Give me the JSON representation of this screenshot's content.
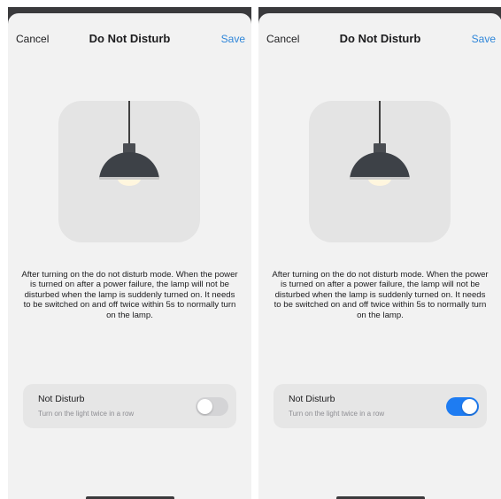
{
  "screens": [
    {
      "nav": {
        "cancel": "Cancel",
        "title": "Do Not Disturb",
        "save": "Save"
      },
      "description": "After turning on the do not disturb mode. When the power is turned on after a power failure, the lamp will not be disturbed when the lamp is suddenly turned on. It needs to be switched on and off twice within 5s to normally turn on the lamp.",
      "setting": {
        "title": "Not Disturb",
        "subtitle": "Turn on the light twice in a row",
        "enabled": false
      }
    },
    {
      "nav": {
        "cancel": "Cancel",
        "title": "Do Not Disturb",
        "save": "Save"
      },
      "description": "After turning on the do not disturb mode. When the power is turned on after a power failure, the lamp will not be disturbed when the lamp is suddenly turned on. It needs to be switched on and off twice within 5s to normally turn on the lamp.",
      "setting": {
        "title": "Not Disturb",
        "subtitle": "Turn on the light twice in a row",
        "enabled": true
      }
    }
  ],
  "colors": {
    "accent": "#2f86d9",
    "toggle_on": "#1e7cf2",
    "toggle_off": "#d4d4d6"
  },
  "icons": {
    "illustration": "pendant-lamp-icon"
  }
}
